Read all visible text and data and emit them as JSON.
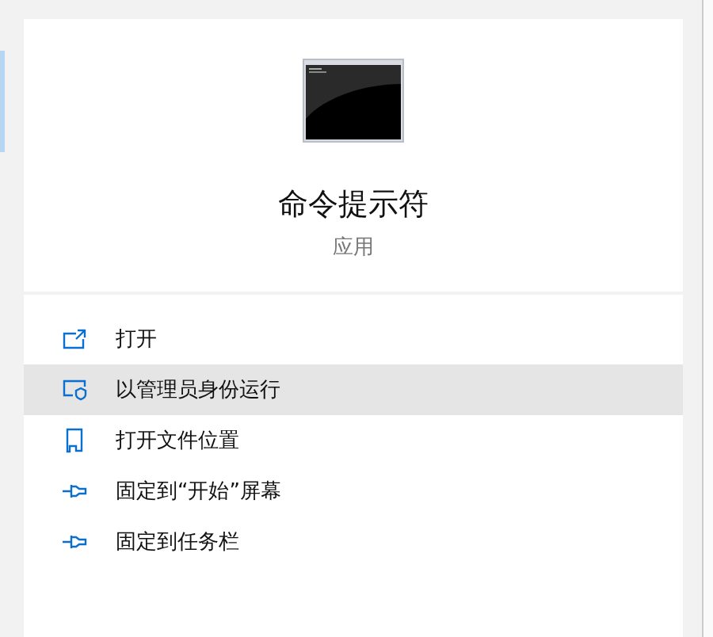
{
  "app": {
    "title": "命令提示符",
    "subtitle": "应用"
  },
  "actions": [
    {
      "label": "打开",
      "kind": "open",
      "selected": false
    },
    {
      "label": "以管理员身份运行",
      "kind": "admin",
      "selected": true
    },
    {
      "label": "打开文件位置",
      "kind": "folder",
      "selected": false
    },
    {
      "label": "固定到“开始”屏幕",
      "kind": "pin",
      "selected": false
    },
    {
      "label": "固定到任务栏",
      "kind": "pin",
      "selected": false
    }
  ]
}
